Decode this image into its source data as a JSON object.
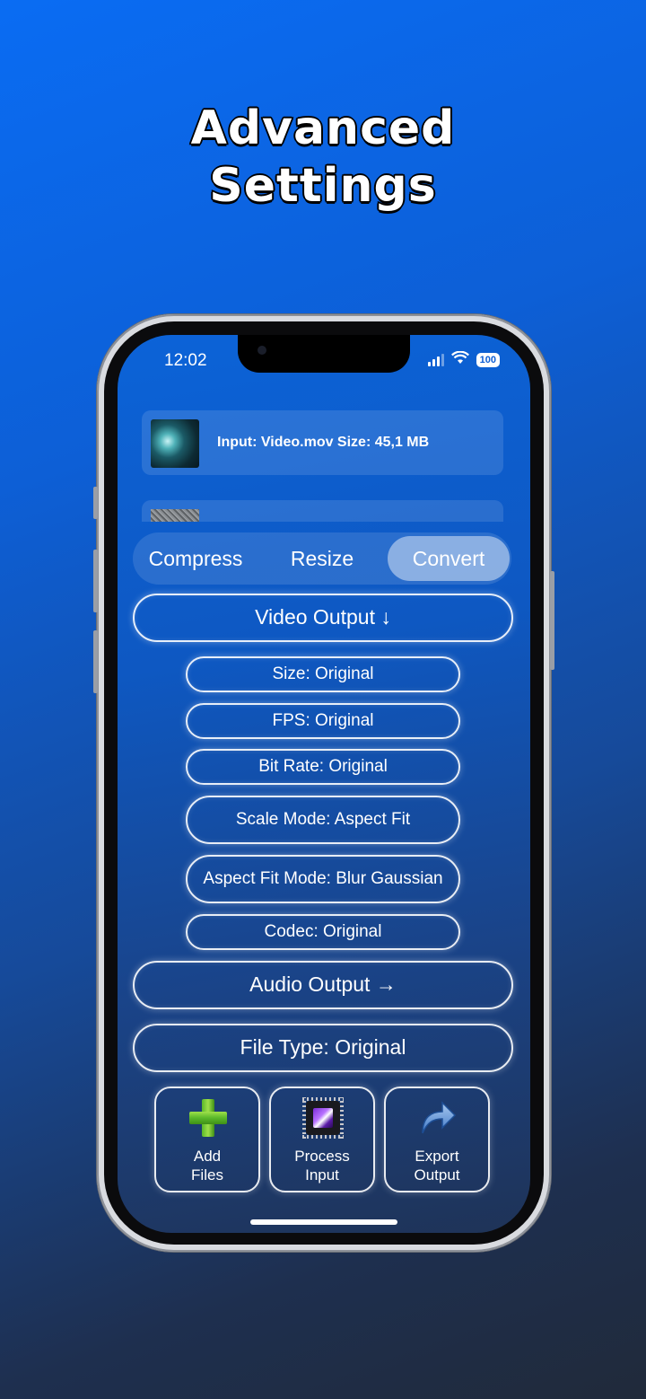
{
  "promo": {
    "headline_line1": "Advanced",
    "headline_line2": "Settings"
  },
  "status_bar": {
    "time": "12:02",
    "battery": "100"
  },
  "files": [
    {
      "label": "Input: Video.mov Size: 45,1 MB"
    }
  ],
  "modes": {
    "tabs": [
      "Compress",
      "Resize",
      "Convert"
    ],
    "selected": "Convert"
  },
  "video_output": {
    "label": "Video Output ↓",
    "options": [
      "Size: Original",
      "FPS: Original",
      "Bit Rate: Original",
      "Scale Mode: Aspect Fit",
      "Aspect Fit Mode: Blur Gaussian",
      "Codec: Original"
    ]
  },
  "audio_output": {
    "label": "Audio Output →"
  },
  "file_type": {
    "label": "File Type: Original"
  },
  "actions": {
    "add": {
      "line1": "Add",
      "line2": "Files",
      "icon": "plus-icon"
    },
    "process": {
      "line1": "Process",
      "line2": "Input",
      "icon": "chip-icon"
    },
    "export": {
      "line1": "Export",
      "line2": "Output",
      "icon": "share-arrow-icon"
    }
  },
  "colors": {
    "background_top": "#0a6cf3",
    "background_bottom": "#202a3a",
    "plus_green": "#5ab82a"
  }
}
